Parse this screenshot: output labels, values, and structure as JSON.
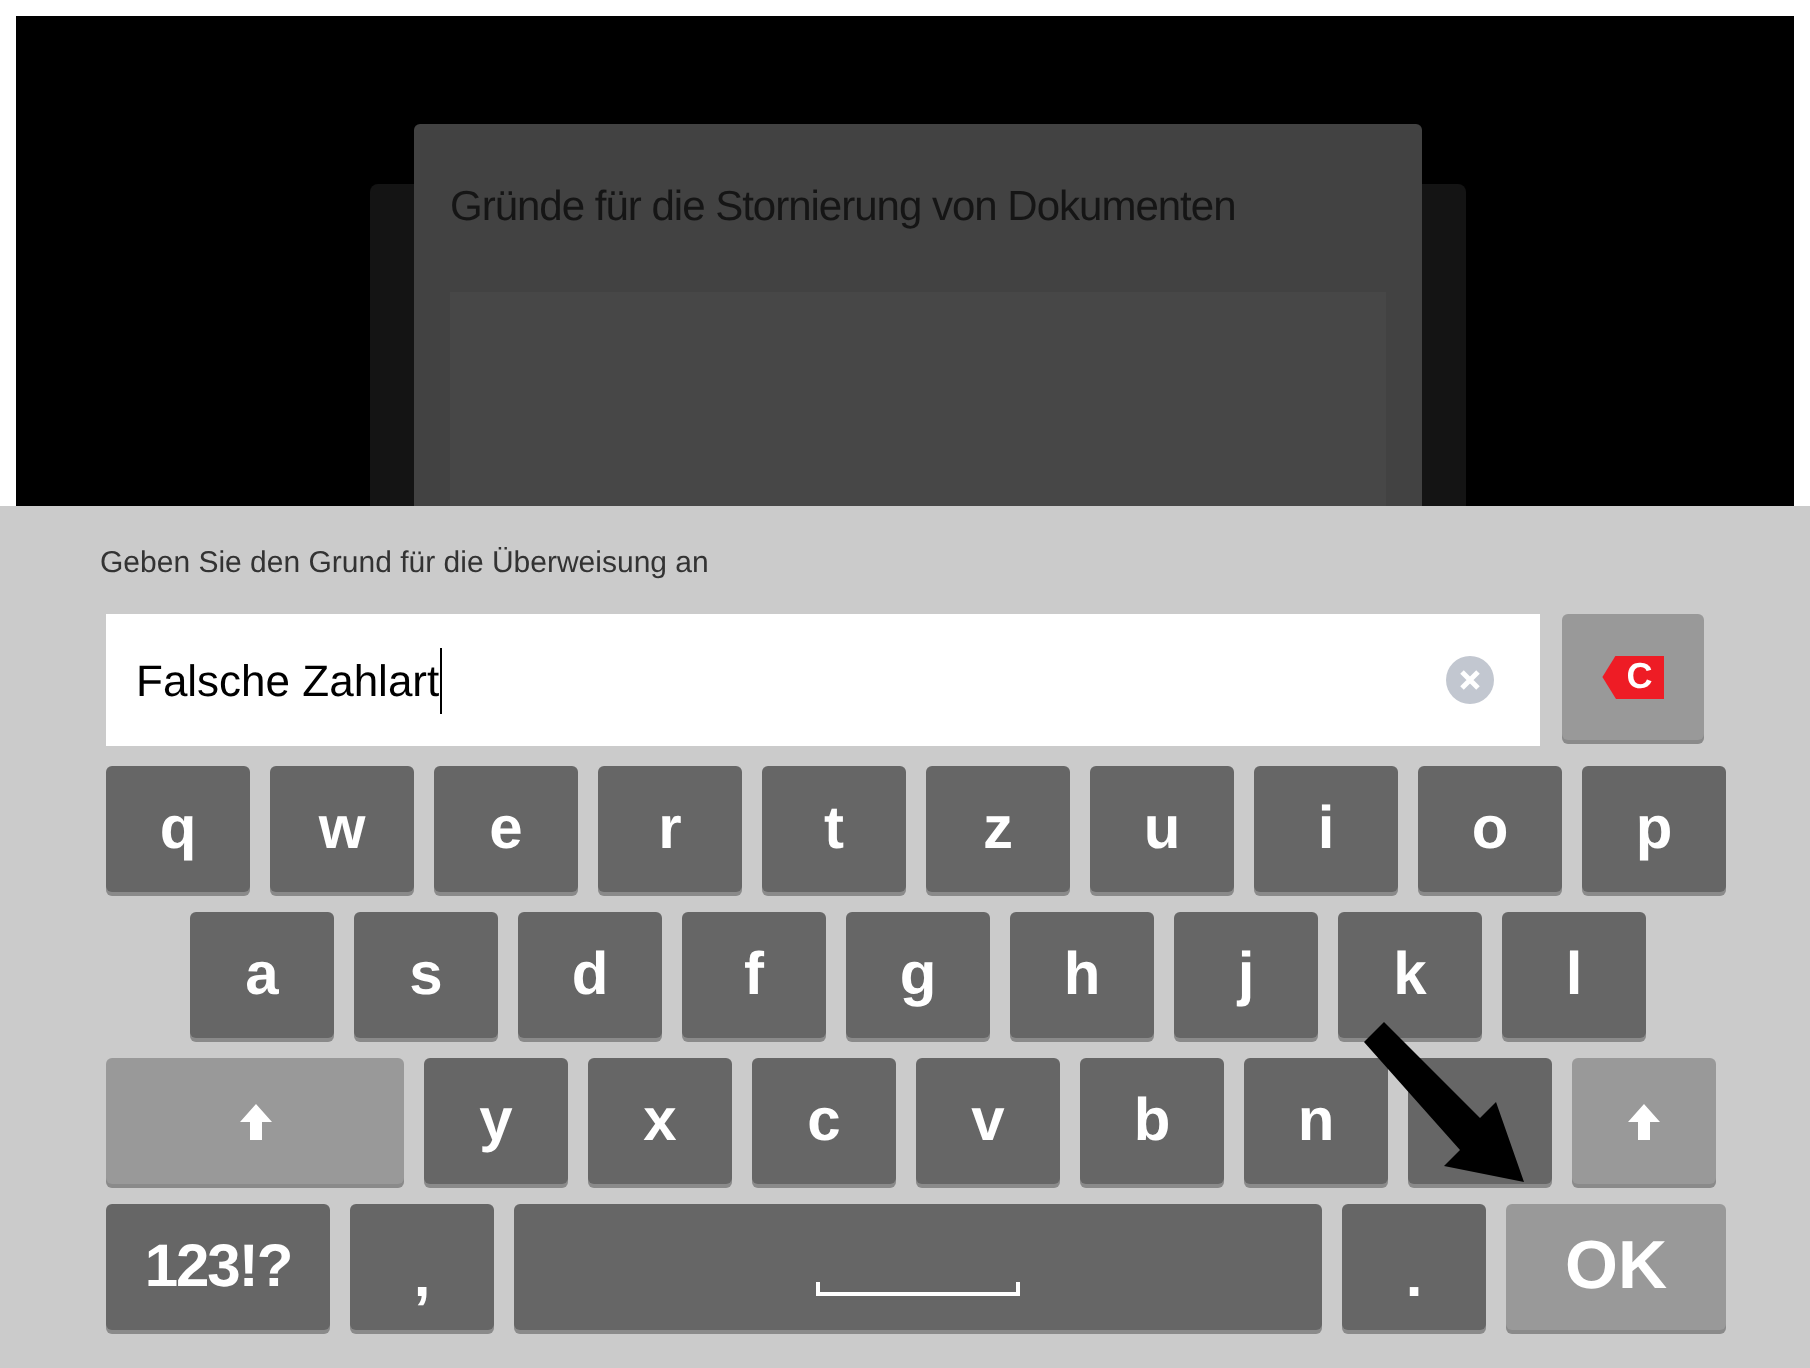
{
  "dialog": {
    "title": "Gründe für die Stornierung von Dokumenten"
  },
  "keyboard": {
    "prompt": "Geben Sie den Grund für die Überweisung an",
    "field": {
      "value": "Falsche Zahlart"
    },
    "delete_key": {
      "label": "C"
    },
    "rows": [
      {
        "keys": [
          {
            "kind": "char",
            "label": "q"
          },
          {
            "kind": "char",
            "label": "w"
          },
          {
            "kind": "char",
            "label": "e"
          },
          {
            "kind": "char",
            "label": "r"
          },
          {
            "kind": "char",
            "label": "t"
          },
          {
            "kind": "char",
            "label": "z"
          },
          {
            "kind": "char",
            "label": "u"
          },
          {
            "kind": "char",
            "label": "i"
          },
          {
            "kind": "char",
            "label": "o"
          },
          {
            "kind": "char",
            "label": "p"
          }
        ]
      },
      {
        "keys": [
          {
            "kind": "char",
            "label": "a"
          },
          {
            "kind": "char",
            "label": "s"
          },
          {
            "kind": "char",
            "label": "d"
          },
          {
            "kind": "char",
            "label": "f"
          },
          {
            "kind": "char",
            "label": "g"
          },
          {
            "kind": "char",
            "label": "h"
          },
          {
            "kind": "char",
            "label": "j"
          },
          {
            "kind": "char",
            "label": "k"
          },
          {
            "kind": "char",
            "label": "l"
          }
        ]
      },
      {
        "keys": [
          {
            "kind": "shift",
            "wide": true
          },
          {
            "kind": "char",
            "label": "y"
          },
          {
            "kind": "char",
            "label": "x"
          },
          {
            "kind": "char",
            "label": "c"
          },
          {
            "kind": "char",
            "label": "v"
          },
          {
            "kind": "char",
            "label": "b"
          },
          {
            "kind": "char",
            "label": "n"
          },
          {
            "kind": "char"
          },
          {
            "kind": "shift",
            "wide": false
          }
        ]
      },
      {
        "keys": [
          {
            "kind": "mode",
            "label": "123!?"
          },
          {
            "kind": "char",
            "label": ","
          },
          {
            "kind": "space"
          },
          {
            "kind": "char",
            "label": "."
          },
          {
            "kind": "ok",
            "label": "OK"
          }
        ]
      }
    ]
  }
}
